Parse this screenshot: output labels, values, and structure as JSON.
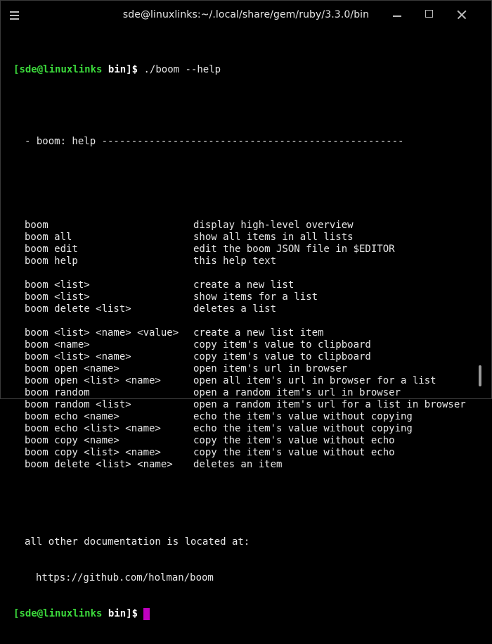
{
  "window": {
    "title": "sde@linuxlinks:~/.local/share/gem/ruby/3.3.0/bin"
  },
  "prompt": {
    "open_bracket": "[",
    "user_host": "sde@linuxlinks",
    "dir": "bin",
    "close": "]$"
  },
  "command": " ./boom --help",
  "help_header": "- boom: help ---------------------------------------------------",
  "groups": [
    [
      {
        "cmd": "boom",
        "desc": "display high-level overview"
      },
      {
        "cmd": "boom all",
        "desc": "show all items in all lists"
      },
      {
        "cmd": "boom edit",
        "desc": "edit the boom JSON file in $EDITOR"
      },
      {
        "cmd": "boom help",
        "desc": "this help text"
      }
    ],
    [
      {
        "cmd": "boom <list>",
        "desc": "create a new list"
      },
      {
        "cmd": "boom <list>",
        "desc": "show items for a list"
      },
      {
        "cmd": "boom delete <list>",
        "desc": "deletes a list"
      }
    ],
    [
      {
        "cmd": "boom <list> <name> <value>",
        "desc": "create a new list item"
      },
      {
        "cmd": "boom <name>",
        "desc": "copy item's value to clipboard"
      },
      {
        "cmd": "boom <list> <name>",
        "desc": "copy item's value to clipboard"
      },
      {
        "cmd": "boom open <name>",
        "desc": "open item's url in browser"
      },
      {
        "cmd": "boom open <list> <name>",
        "desc": "open all item's url in browser for a list"
      },
      {
        "cmd": "boom random",
        "desc": "open a random item's url in browser"
      },
      {
        "cmd": "boom random <list>",
        "desc": "open a random item's url for a list in browser"
      },
      {
        "cmd": "boom echo <name>",
        "desc": "echo the item's value without copying"
      },
      {
        "cmd": "boom echo <list> <name>",
        "desc": "echo the item's value without copying"
      },
      {
        "cmd": "boom copy <name>",
        "desc": "copy the item's value without echo"
      },
      {
        "cmd": "boom copy <list> <name>",
        "desc": "copy the item's value without echo"
      },
      {
        "cmd": "boom delete <list> <name>",
        "desc": "deletes an item"
      }
    ]
  ],
  "footer": {
    "doc_line": "all other documentation is located at:",
    "url": "https://github.com/holman/boom"
  },
  "colors": {
    "prompt_green": "#3bd83b",
    "cursor_magenta": "#c000c0",
    "text": "#e6e6e6",
    "background": "#000000"
  },
  "icons": {
    "menu": "hamburger-menu-icon",
    "minimize": "minimize-icon",
    "maximize": "maximize-icon",
    "close": "close-icon"
  }
}
